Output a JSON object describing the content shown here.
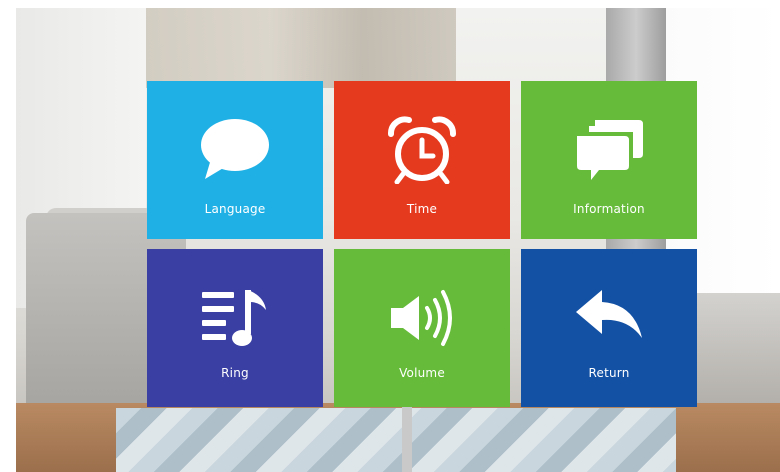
{
  "menu": {
    "tiles": [
      {
        "label": "Language",
        "icon": "speech-bubble-icon",
        "color": "#1fb1e6"
      },
      {
        "label": "Time",
        "icon": "alarm-clock-icon",
        "color": "#e63a1f"
      },
      {
        "label": "Information",
        "icon": "messages-icon",
        "color": "#66bb3a"
      },
      {
        "label": "Ring",
        "icon": "playlist-music-icon",
        "color": "#3a3fa3"
      },
      {
        "label": "Volume",
        "icon": "speaker-volume-icon",
        "color": "#66bb3a"
      },
      {
        "label": "Return",
        "icon": "return-arrow-icon",
        "color": "#1351a5"
      }
    ]
  }
}
